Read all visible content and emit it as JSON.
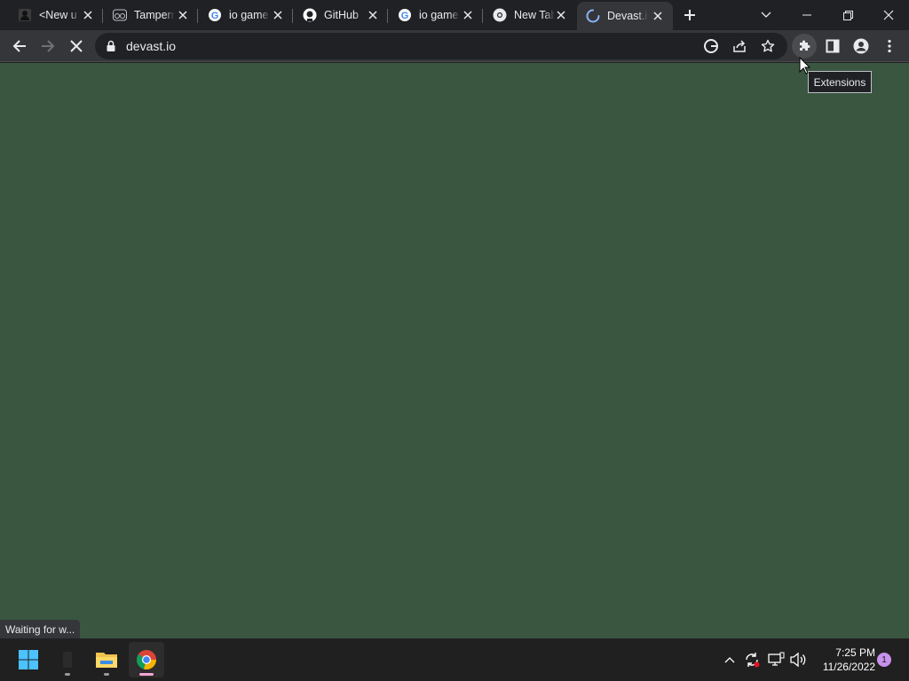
{
  "browser": {
    "tabs": [
      {
        "title": "<New u",
        "icon": "github-user-icon"
      },
      {
        "title": "Tamperm",
        "icon": "tampermonkey-icon"
      },
      {
        "title": "io game",
        "icon": "google-icon"
      },
      {
        "title": "GitHub",
        "icon": "github-icon"
      },
      {
        "title": "io game",
        "icon": "google-icon"
      },
      {
        "title": "New Tab",
        "icon": "chrome-icon"
      },
      {
        "title": "Devast.io",
        "icon": "loading-spinner-icon"
      }
    ],
    "active_tab_index": 6,
    "address": "devast.io",
    "tooltip": "Extensions",
    "status_text": "Waiting for w..."
  },
  "page": {
    "background_color": "#3a5641"
  },
  "taskbar": {
    "time": "7:25 PM",
    "date": "11/26/2022",
    "notification_count": "1"
  }
}
